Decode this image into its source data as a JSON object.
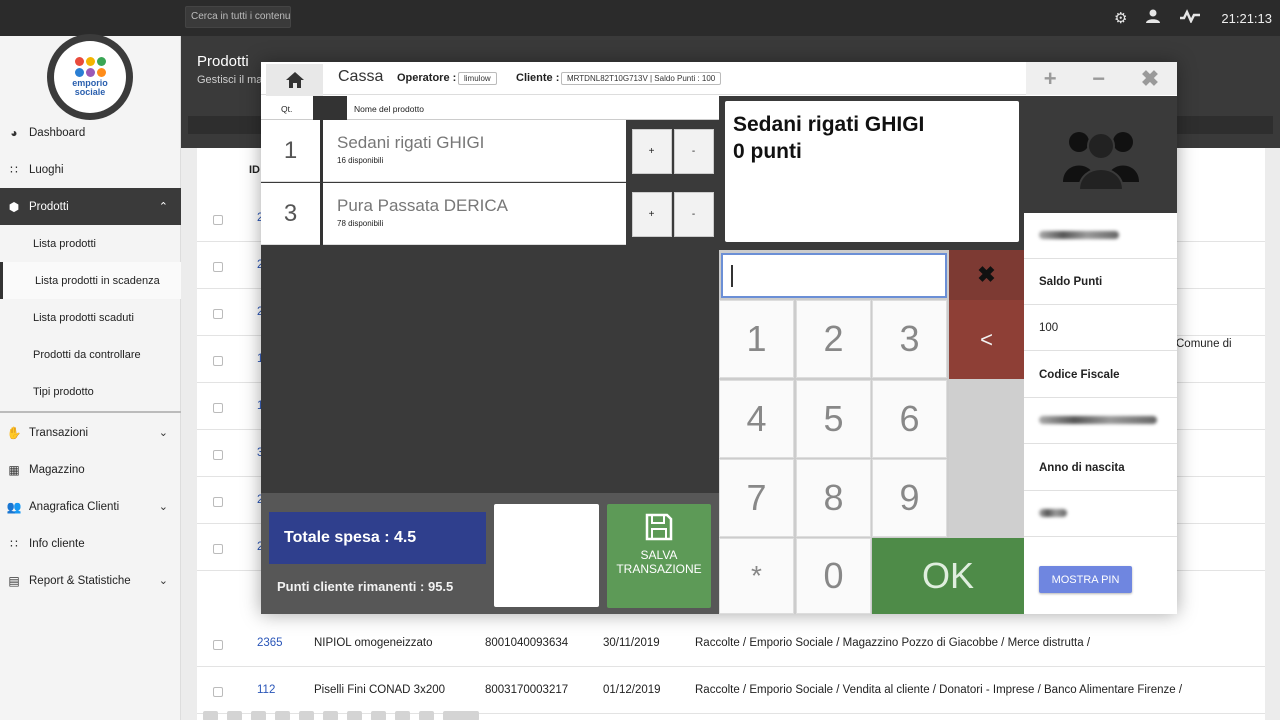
{
  "topbar": {
    "search_placeholder": "Cerca in tutti i contenuti",
    "clock": "21:21:13",
    "icons": [
      "gear-icon",
      "user-icon",
      "activity-icon"
    ]
  },
  "logo": {
    "line1": "emporio",
    "line2": "sociale"
  },
  "sidebar": {
    "items": [
      {
        "label": "Dashboard",
        "icon": "dashboard-icon"
      },
      {
        "label": "Luoghi",
        "icon": "grid-icon"
      },
      {
        "label": "Prodotti",
        "icon": "cube-icon",
        "expanded": true
      }
    ],
    "sub_items": [
      "Lista prodotti",
      "Lista prodotti in scadenza",
      "Lista prodotti scaduti",
      "Prodotti da controllare",
      "Tipi prodotto"
    ],
    "items_after": [
      {
        "label": "Transazioni",
        "icon": "hand-icon"
      },
      {
        "label": "Magazzino",
        "icon": "warehouse-icon"
      },
      {
        "label": "Anagrafica Clienti",
        "icon": "users-icon"
      },
      {
        "label": "Info cliente",
        "icon": "grid-icon"
      },
      {
        "label": "Report & Statistiche",
        "icon": "report-icon"
      }
    ]
  },
  "page": {
    "title": "Prodotti",
    "subtitle": "Gestisci il mag",
    "id_header": "ID",
    "peek_text": "Comune di",
    "rows": [
      {
        "id": "2",
        "c1": "",
        "c2": "",
        "c3": "",
        "c4": ""
      },
      {
        "id": "2",
        "c1": "",
        "c2": "",
        "c3": "",
        "c4": ""
      },
      {
        "id": "2",
        "c1": "",
        "c2": "",
        "c3": "",
        "c4": ""
      },
      {
        "id": "1",
        "c1": "",
        "c2": "",
        "c3": "",
        "c4": ""
      },
      {
        "id": "1",
        "c1": "",
        "c2": "",
        "c3": "",
        "c4": ""
      },
      {
        "id": "3",
        "c1": "",
        "c2": "",
        "c3": "",
        "c4": ""
      },
      {
        "id": "2",
        "c1": "",
        "c2": "",
        "c3": "",
        "c4": ""
      },
      {
        "id": "2",
        "c1": "",
        "c2": "",
        "c3": "",
        "c4": ""
      },
      {
        "id": "2365",
        "c1": "NIPIOL omogeneizzato",
        "c2": "8001040093634",
        "c3": "30/11/2019",
        "c4": "Raccolte / Emporio Sociale / Magazzino Pozzo di Giacobbe / Merce distrutta /"
      },
      {
        "id": "112",
        "c1": "Piselli Fini CONAD 3x200",
        "c2": "8003170003217",
        "c3": "01/12/2019",
        "c4": "Raccolte / Emporio Sociale / Vendita al cliente / Donatori - Imprese / Banco Alimentare Firenze /"
      }
    ]
  },
  "modal": {
    "title": "Cassa",
    "operator_label": "Operatore :",
    "operator_value": "limulow",
    "client_label": "Cliente :",
    "client_value": "MRTDNL82T10G713V | Saldo Punti : 100",
    "controls": [
      "+",
      "−",
      "✖"
    ],
    "col_qty": "Qt.",
    "col_name": "Nome del prodotto",
    "cart": [
      {
        "qty": "1",
        "name": "Sedani rigati GHIGI",
        "available": "16 disponibili"
      },
      {
        "qty": "3",
        "name": "Pura Passata DERICA",
        "available": "78 disponibili"
      }
    ],
    "btn_plus": "+",
    "btn_minus": "-",
    "total": "Totale spesa : 4.5",
    "points_left": "Punti cliente rimanenti : 95.5",
    "save_line1": "SALVA",
    "save_line2": "TRANSAZIONE",
    "selected_product": "Sedani rigati GHIGI",
    "selected_points": "0 punti",
    "keypad": {
      "keys": [
        "1",
        "2",
        "3",
        "4",
        "5",
        "6",
        "7",
        "8",
        "9",
        "*",
        "0"
      ],
      "ok": "OK",
      "clear": "✖",
      "back": "<"
    },
    "customer": {
      "saldo_label": "Saldo Punti",
      "saldo_value": "100",
      "cf_label": "Codice Fiscale",
      "anno_label": "Anno di nascita",
      "pin_button": "MOSTRA PIN"
    }
  },
  "colors": {
    "total_box": "#2f3f8d",
    "save_button": "#5d9a57",
    "ok_key": "#4e8b48",
    "clear_key": "#7d3a33",
    "pin_button": "#6f86e0"
  }
}
